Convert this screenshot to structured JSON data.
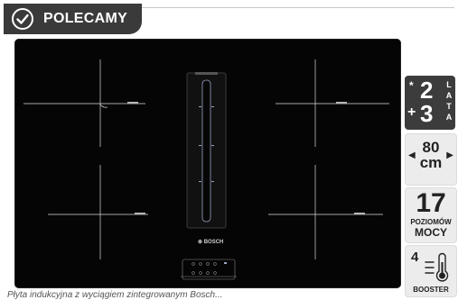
{
  "badge": {
    "label": "POLECAMY"
  },
  "cooktop": {
    "brand": "⊕ BOSCH",
    "model_tl": "",
    "model_tr": ""
  },
  "features": {
    "warranty": {
      "star": "*",
      "plus": "+",
      "big1": "2",
      "big2": "3",
      "vertical": [
        "L",
        "A",
        "T",
        "A"
      ]
    },
    "width": {
      "value": "80",
      "unit": "cm"
    },
    "levels": {
      "value": "17",
      "line1": "POZIOMÓW",
      "line2": "MOCY"
    },
    "booster": {
      "value": "4",
      "label": "BOOSTER"
    }
  },
  "caption": "Płyta indukcyjna z wyciągiem zintegrowanym Bosch..."
}
